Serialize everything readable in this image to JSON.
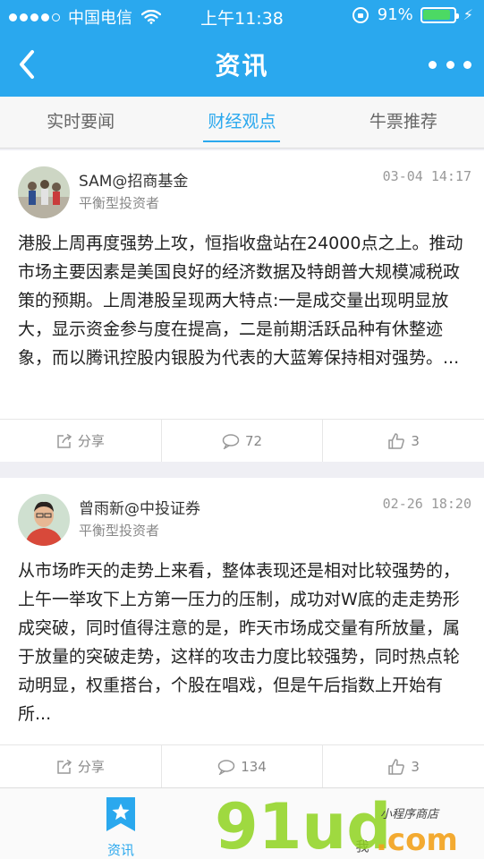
{
  "status_bar": {
    "carrier": "中国电信",
    "time": "上午11:38",
    "battery": "91%",
    "battery_level": 0.91
  },
  "nav": {
    "title": "资讯"
  },
  "tabs": [
    {
      "label": "实时要闻",
      "active": false
    },
    {
      "label": "财经观点",
      "active": true
    },
    {
      "label": "牛票推荐",
      "active": false
    }
  ],
  "posts": [
    {
      "author": "SAM@招商基金",
      "type": "平衡型投资者",
      "time": "03-04 14:17",
      "content": "港股上周再度强势上攻，恒指收盘站在24000点之上。推动市场主要因素是美国良好的经济数据及特朗普大规模减税政策的预期。上周港股呈现两大特点:一是成交量出现明显放大，显示资金参与度在提高，二是前期活跃品种有休整迹象，而以腾讯控股内银股为代表的大蓝筹保持相对强势。...",
      "share": "分享",
      "comments": "72",
      "likes": "3"
    },
    {
      "author": "曾雨新@中投证券",
      "type": "平衡型投资者",
      "time": "02-26 18:20",
      "content": "从市场昨天的走势上来看，整体表现还是相对比较强势的，上午一举攻下上方第一压力的压制，成功对W底的走走势形成突破，同时值得注意的是，昨天市场成交量有所放量，属于放量的突破走势，这样的攻击力度比较强势，同时热点轮动明显，权重搭台，个股在唱戏，但是午后指数上开始有所...",
      "share": "分享",
      "comments": "134",
      "likes": "3"
    }
  ],
  "tabbar": {
    "news_label": "资讯",
    "me_label": "我"
  },
  "watermark": {
    "text": "91ud.com",
    "subtext": "小程序商店"
  },
  "colors": {
    "accent": "#2aa8ee",
    "battery": "#4cd964"
  }
}
